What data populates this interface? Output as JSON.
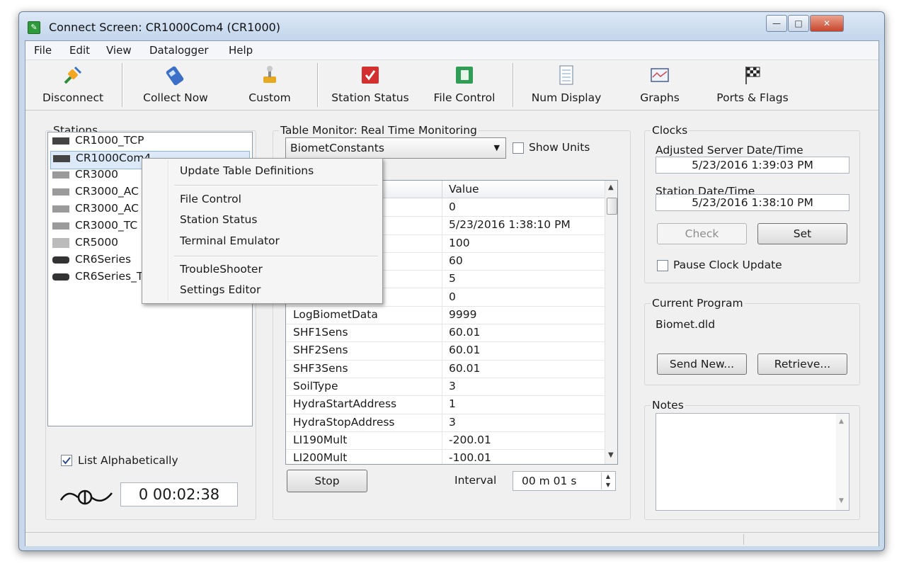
{
  "window": {
    "title": "Connect Screen: CR1000Com4 (CR1000)",
    "controls": [
      "minimize-icon",
      "maximize-icon",
      "close-icon"
    ]
  },
  "menu": [
    "File",
    "Edit",
    "View",
    "Datalogger",
    "Help"
  ],
  "toolbar": {
    "disconnect": "Disconnect",
    "collect_now": "Collect Now",
    "custom": "Custom",
    "station_status": "Station Status",
    "file_control": "File Control",
    "num_display": "Num Display",
    "graphs": "Graphs",
    "ports_flags": "Ports & Flags"
  },
  "stations": {
    "title": "Stations",
    "items": [
      "CR1000_TCP",
      "CR1000Com4",
      "CR3000",
      "CR3000_AC",
      "CR3000_AC",
      "CR3000_TC",
      "CR5000",
      "CR6Series",
      "CR6Series_T"
    ],
    "selected": "CR1000Com4",
    "list_alphabetically": "List Alphabetically",
    "timer": "0 00:02:38"
  },
  "context_menu": [
    "Update Table Definitions",
    "File Control",
    "Station Status",
    "Terminal Emulator",
    "TroubleShooter",
    "Settings Editor"
  ],
  "table_monitor": {
    "title": "Table Monitor: Real Time Monitoring",
    "table_select": "BiometConstants",
    "show_units": "Show Units",
    "value_header": "Value",
    "partial_name": "e",
    "rows": [
      {
        "name": "",
        "value": "0"
      },
      {
        "name": "",
        "value": "5/23/2016 1:38:10 PM"
      },
      {
        "name": "",
        "value": "100"
      },
      {
        "name": "",
        "value": "60"
      },
      {
        "name": "",
        "value": "5"
      },
      {
        "name": "",
        "value": "0"
      },
      {
        "name": "LogBiometData",
        "value": "9999"
      },
      {
        "name": "SHF1Sens",
        "value": "60.01"
      },
      {
        "name": "SHF2Sens",
        "value": "60.01"
      },
      {
        "name": "SHF3Sens",
        "value": "60.01"
      },
      {
        "name": "SoilType",
        "value": "3"
      },
      {
        "name": "HydraStartAddress",
        "value": "1"
      },
      {
        "name": "HydraStopAddress",
        "value": "3"
      },
      {
        "name": "LI190Mult",
        "value": "-200.01"
      },
      {
        "name": "LI200Mult",
        "value": "-100.01"
      }
    ],
    "stop": "Stop",
    "interval_label": "Interval",
    "interval_value": "00 m 01 s"
  },
  "clocks": {
    "title": "Clocks",
    "server_label": "Adjusted Server Date/Time",
    "server_value": "5/23/2016 1:39:03 PM",
    "station_label": "Station Date/Time",
    "station_value": "5/23/2016 1:38:10 PM",
    "check": "Check",
    "set": "Set",
    "pause": "Pause Clock Update"
  },
  "program": {
    "title": "Current Program",
    "name": "Biomet.dld",
    "send_new": "Send New...",
    "retrieve": "Retrieve..."
  },
  "notes": {
    "title": "Notes"
  }
}
